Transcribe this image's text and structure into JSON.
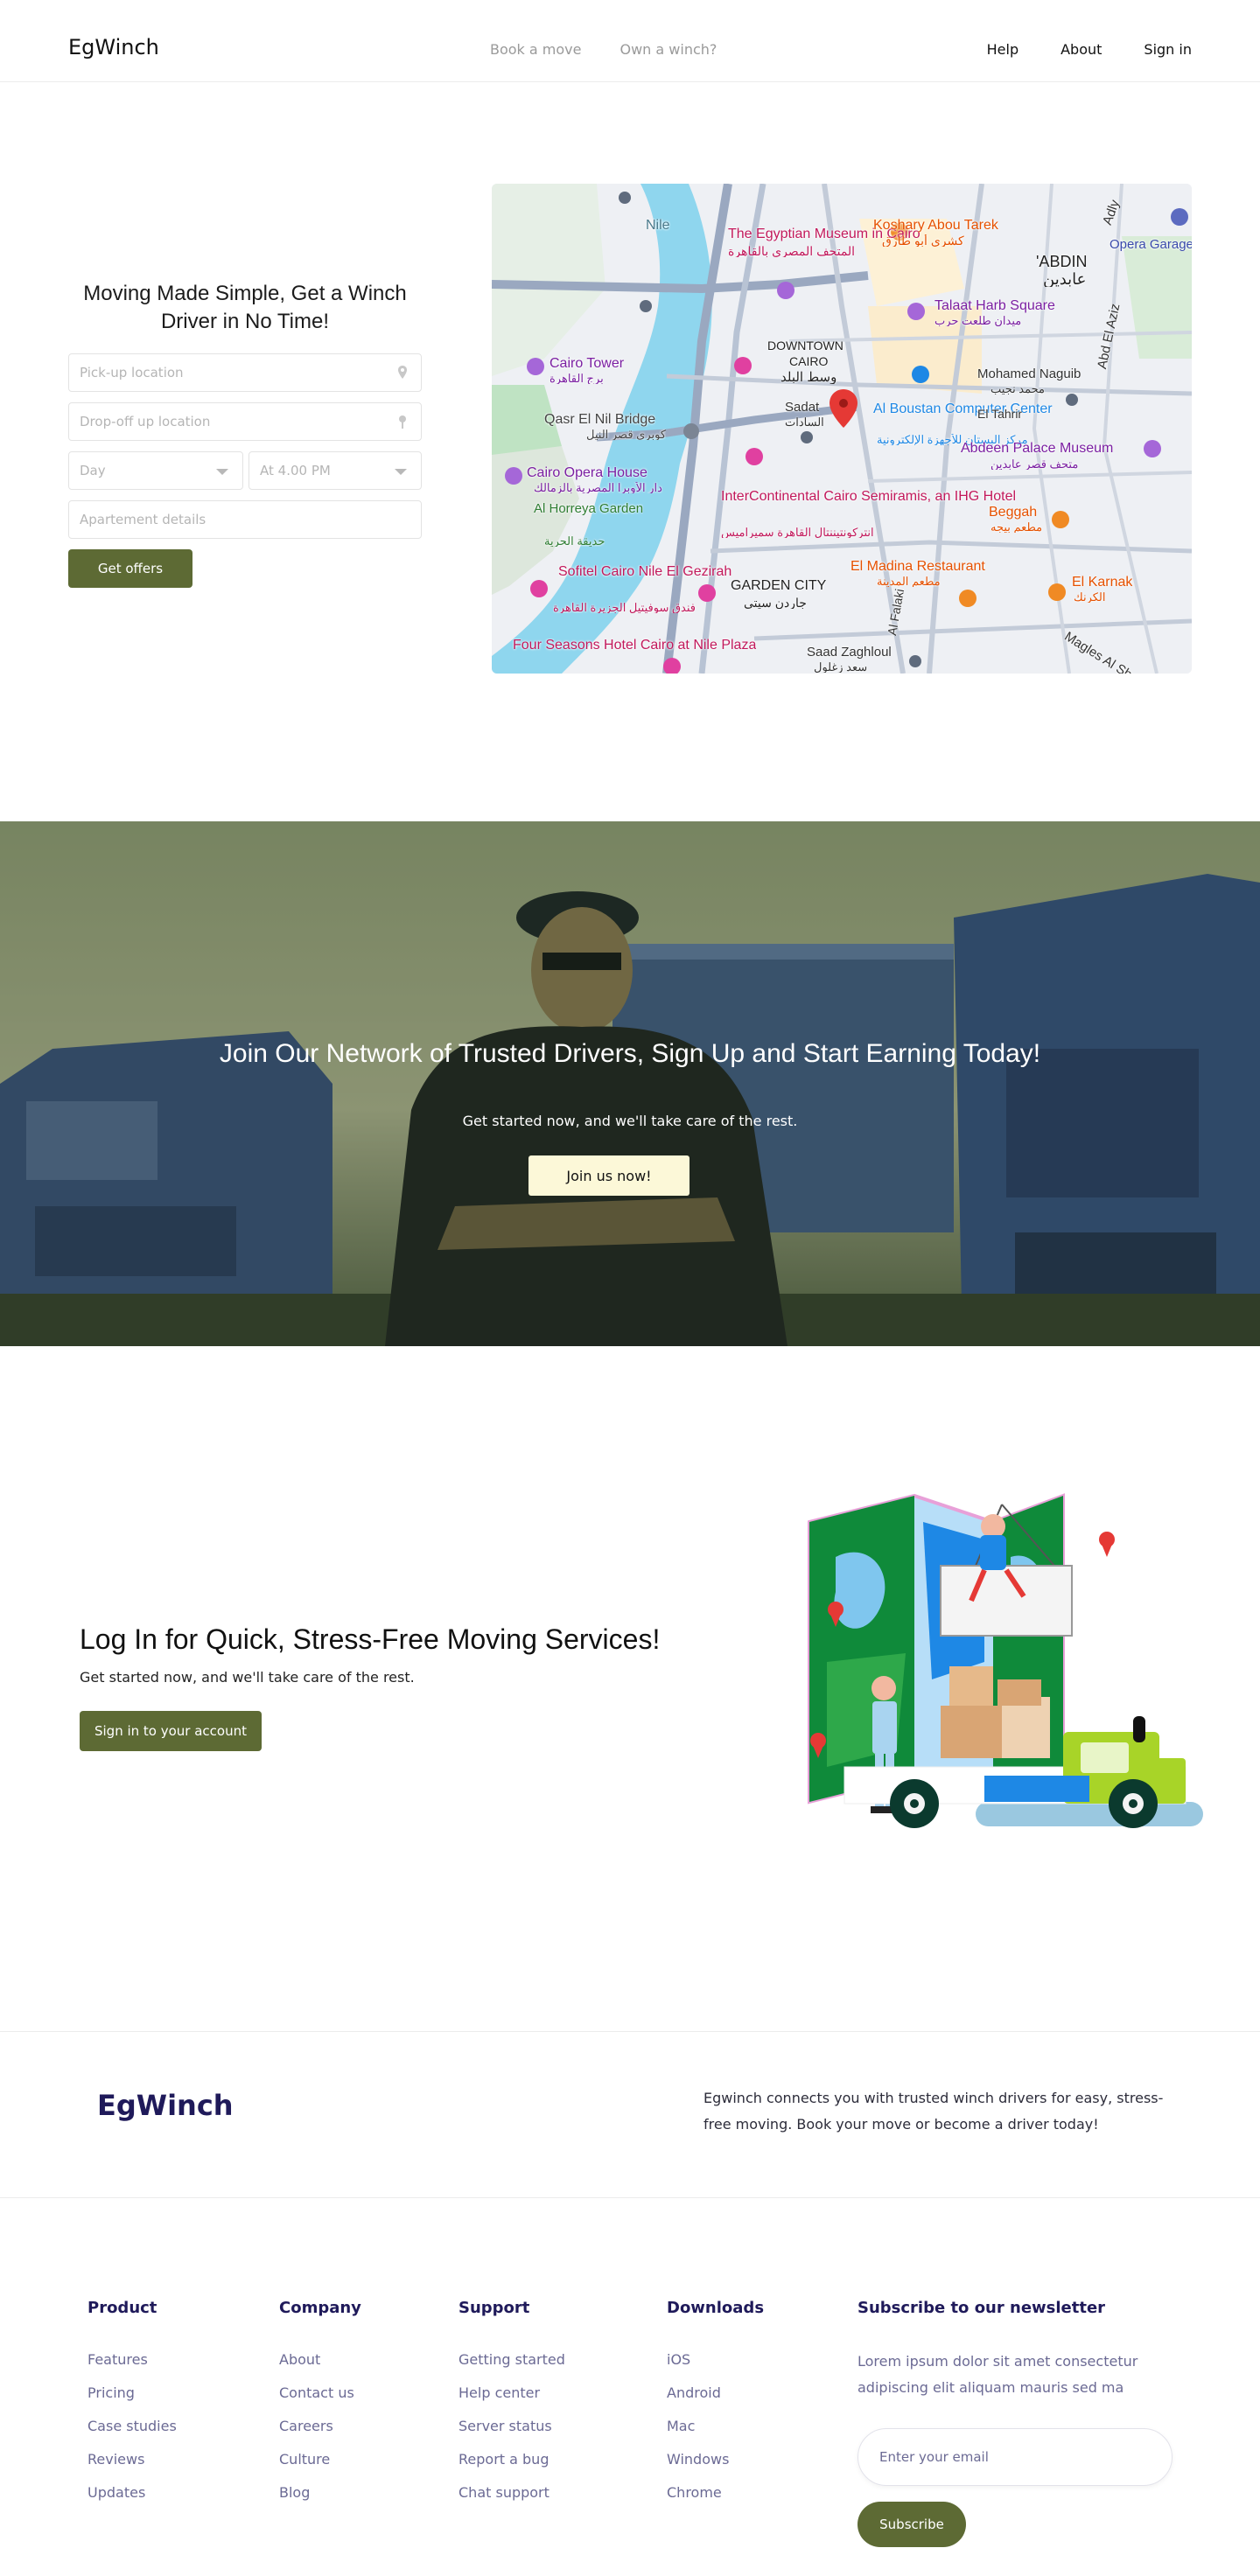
{
  "nav": {
    "brand": "EgWinch",
    "center_links": [
      "Book a move",
      "Own a winch?"
    ],
    "right_links": [
      "Help",
      "About",
      "Sign in"
    ]
  },
  "hero": {
    "title": "Moving Made Simple, Get a Winch Driver in No Time!",
    "pickup_placeholder": "Pick-up location",
    "dropoff_placeholder": "Drop-off up location",
    "day_value": "Day",
    "time_value": "At 4.00 PM",
    "details_placeholder": "Apartement details",
    "cta": "Get offers"
  },
  "map": {
    "labels": [
      "The Egyptian Museum in Cairo",
      "المتحف المصري بالقاهرة",
      "Koshary Abou Tarek",
      "كشري أبو طارق",
      "'ABDIN",
      "عابدين",
      "Talaat Harb Square",
      "ميدان طلعت حرب",
      "Opera Garage",
      "DOWNTOWN",
      "CAIRO",
      "وسط البلد",
      "Cairo Tower",
      "برج القاهرة",
      "Mohamed Naguib",
      "محمد نجيب",
      "Sadat",
      "السادات",
      "Al Boustan Computer Center",
      "مركز البستان للأجهزة الإلكترونية",
      "El Tahrir",
      "Qasr El Nil Bridge",
      "كوبري قصر النيل",
      "Abdeen Palace Museum",
      "متحف قصر عابدين",
      "Cairo Opera House",
      "دار الأوبرا المصرية بالزمالك",
      "Al Horreya Garden",
      "حديقة الحرية",
      "InterContinental Cairo Semiramis, an IHG Hotel",
      "انتركونتيننتال القاهرة سميراميس",
      "Beggah",
      "مطعم بيجه",
      "Sofitel Cairo Nile El Gezirah",
      "فندق سوفيتيل الجزيرة القاهرة",
      "GARDEN CITY",
      "جاردن سيتي",
      "El Madina Restaurant",
      "مطعم المدينة",
      "El Karnak",
      "الكرنك",
      "Four Seasons Hotel Cairo at Nile Plaza",
      "Saad Zaghloul",
      "سعد زغلول",
      "Nile",
      "Adly",
      "Abd El Aziz",
      "Al Falaki",
      "Magles Al Shaeb"
    ]
  },
  "driver_band": {
    "title": "Join Our Network of Trusted Drivers, Sign Up and Start Earning Today!",
    "subtitle": "Get started now, and we'll take care of the rest.",
    "cta": "Join us now!"
  },
  "login": {
    "title": "Log In for Quick, Stress-Free Moving Services!",
    "subtitle": "Get started now, and we'll take care of the rest.",
    "cta": "Sign in to your account"
  },
  "footer": {
    "brand": "EgWinch",
    "description": "Egwinch connects you with trusted winch drivers for easy, stress-free moving. Book your move or become a driver today!",
    "columns": [
      {
        "title": "Product",
        "links": [
          "Features",
          "Pricing",
          "Case studies",
          "Reviews",
          "Updates"
        ]
      },
      {
        "title": "Company",
        "links": [
          "About",
          "Contact us",
          "Careers",
          "Culture",
          "Blog"
        ]
      },
      {
        "title": "Support",
        "links": [
          "Getting started",
          "Help center",
          "Server status",
          "Report a bug",
          "Chat support"
        ]
      },
      {
        "title": "Downloads",
        "links": [
          "iOS",
          "Android",
          "Mac",
          "Windows",
          "Chrome"
        ]
      }
    ],
    "newsletter": {
      "title": "Subscribe to our newsletter",
      "text": "Lorem ipsum dolor sit amet consectetur adipiscing elit aliquam mauris sed ma",
      "email_placeholder": "Enter your email",
      "cta": "Subscribe"
    }
  },
  "colors": {
    "olive": "#5d6a34",
    "navy": "#1f1a5a",
    "cream": "#fcf8d8",
    "river": "#8fd6ee"
  }
}
